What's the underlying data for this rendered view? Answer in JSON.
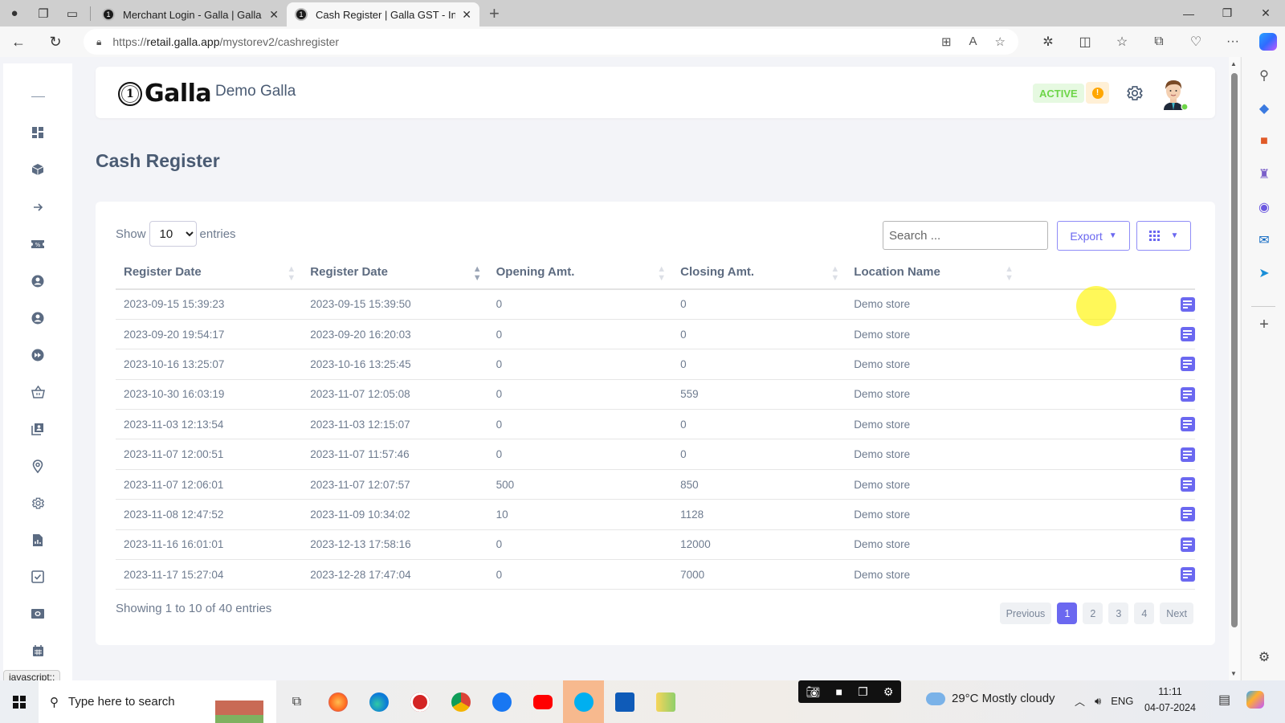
{
  "browser": {
    "tabs": [
      {
        "title": "Merchant Login - Galla | Galla GS",
        "active": false
      },
      {
        "title": "Cash Register | Galla GST - Invent",
        "active": true
      }
    ],
    "url_prefix": "https://",
    "url_domain": "retail.galla.app",
    "url_path": "/mystorev2/cashregister",
    "status_url": "javascript:;"
  },
  "header": {
    "brand": "Galla",
    "store_name": "Demo Galla",
    "status_badge": "ACTIVE",
    "alert_glyph": "!",
    "colors": {
      "accent": "#6b68f0",
      "active_green": "#6dd548",
      "alert_orange": "#ffa600"
    }
  },
  "sidebar": {
    "items": [
      {
        "icon": "collapse-dash-icon"
      },
      {
        "icon": "dashboard-icon"
      },
      {
        "icon": "box-icon"
      },
      {
        "icon": "arrow-right-icon"
      },
      {
        "icon": "discount-ticket-icon"
      },
      {
        "icon": "user-circle-icon"
      },
      {
        "icon": "user-circle-icon"
      },
      {
        "icon": "fast-forward-icon"
      },
      {
        "icon": "basket-icon"
      },
      {
        "icon": "contacts-icon"
      },
      {
        "icon": "location-pin-icon"
      },
      {
        "icon": "settings-icon"
      },
      {
        "icon": "report-icon"
      },
      {
        "icon": "checkbox-icon"
      },
      {
        "icon": "cash-icon"
      },
      {
        "icon": "calendar-icon"
      }
    ]
  },
  "page": {
    "title": "Cash Register",
    "show_label": "Show",
    "entries_label": "entries",
    "page_size": "10",
    "search_placeholder": "Search ...",
    "export_label": "Export",
    "columns": [
      "Register Date",
      "Register Date",
      "Opening Amt.",
      "Closing Amt.",
      "Location Name",
      ""
    ],
    "rows": [
      {
        "open_date": "2023-09-15 15:39:23",
        "close_date": "2023-09-15 15:39:50",
        "opening": "0",
        "closing": "0",
        "location": "Demo store"
      },
      {
        "open_date": "2023-09-20 19:54:17",
        "close_date": "2023-09-20 16:20:03",
        "opening": "0",
        "closing": "0",
        "location": "Demo store"
      },
      {
        "open_date": "2023-10-16 13:25:07",
        "close_date": "2023-10-16 13:25:45",
        "opening": "0",
        "closing": "0",
        "location": "Demo store"
      },
      {
        "open_date": "2023-10-30 16:03:19",
        "close_date": "2023-11-07 12:05:08",
        "opening": "0",
        "closing": "559",
        "location": "Demo store"
      },
      {
        "open_date": "2023-11-03 12:13:54",
        "close_date": "2023-11-03 12:15:07",
        "opening": "0",
        "closing": "0",
        "location": "Demo store"
      },
      {
        "open_date": "2023-11-07 12:00:51",
        "close_date": "2023-11-07 11:57:46",
        "opening": "0",
        "closing": "0",
        "location": "Demo store"
      },
      {
        "open_date": "2023-11-07 12:06:01",
        "close_date": "2023-11-07 12:07:57",
        "opening": "500",
        "closing": "850",
        "location": "Demo store"
      },
      {
        "open_date": "2023-11-08 12:47:52",
        "close_date": "2023-11-09 10:34:02",
        "opening": "10",
        "closing": "1128",
        "location": "Demo store"
      },
      {
        "open_date": "2023-11-16 16:01:01",
        "close_date": "2023-12-13 17:58:16",
        "opening": "0",
        "closing": "12000",
        "location": "Demo store"
      },
      {
        "open_date": "2023-11-17 15:27:04",
        "close_date": "2023-12-28 17:47:04",
        "opening": "0",
        "closing": "7000",
        "location": "Demo store"
      }
    ],
    "info": "Showing 1 to 10 of 40 entries",
    "pagination": {
      "previous": "Previous",
      "pages": [
        "1",
        "2",
        "3",
        "4"
      ],
      "current": "1",
      "next": "Next"
    }
  },
  "taskbar": {
    "search_placeholder": "Type here to search",
    "weather": "29°C  Mostly cloudy",
    "language": "ENG",
    "time": "11:11",
    "date": "04-07-2024"
  }
}
